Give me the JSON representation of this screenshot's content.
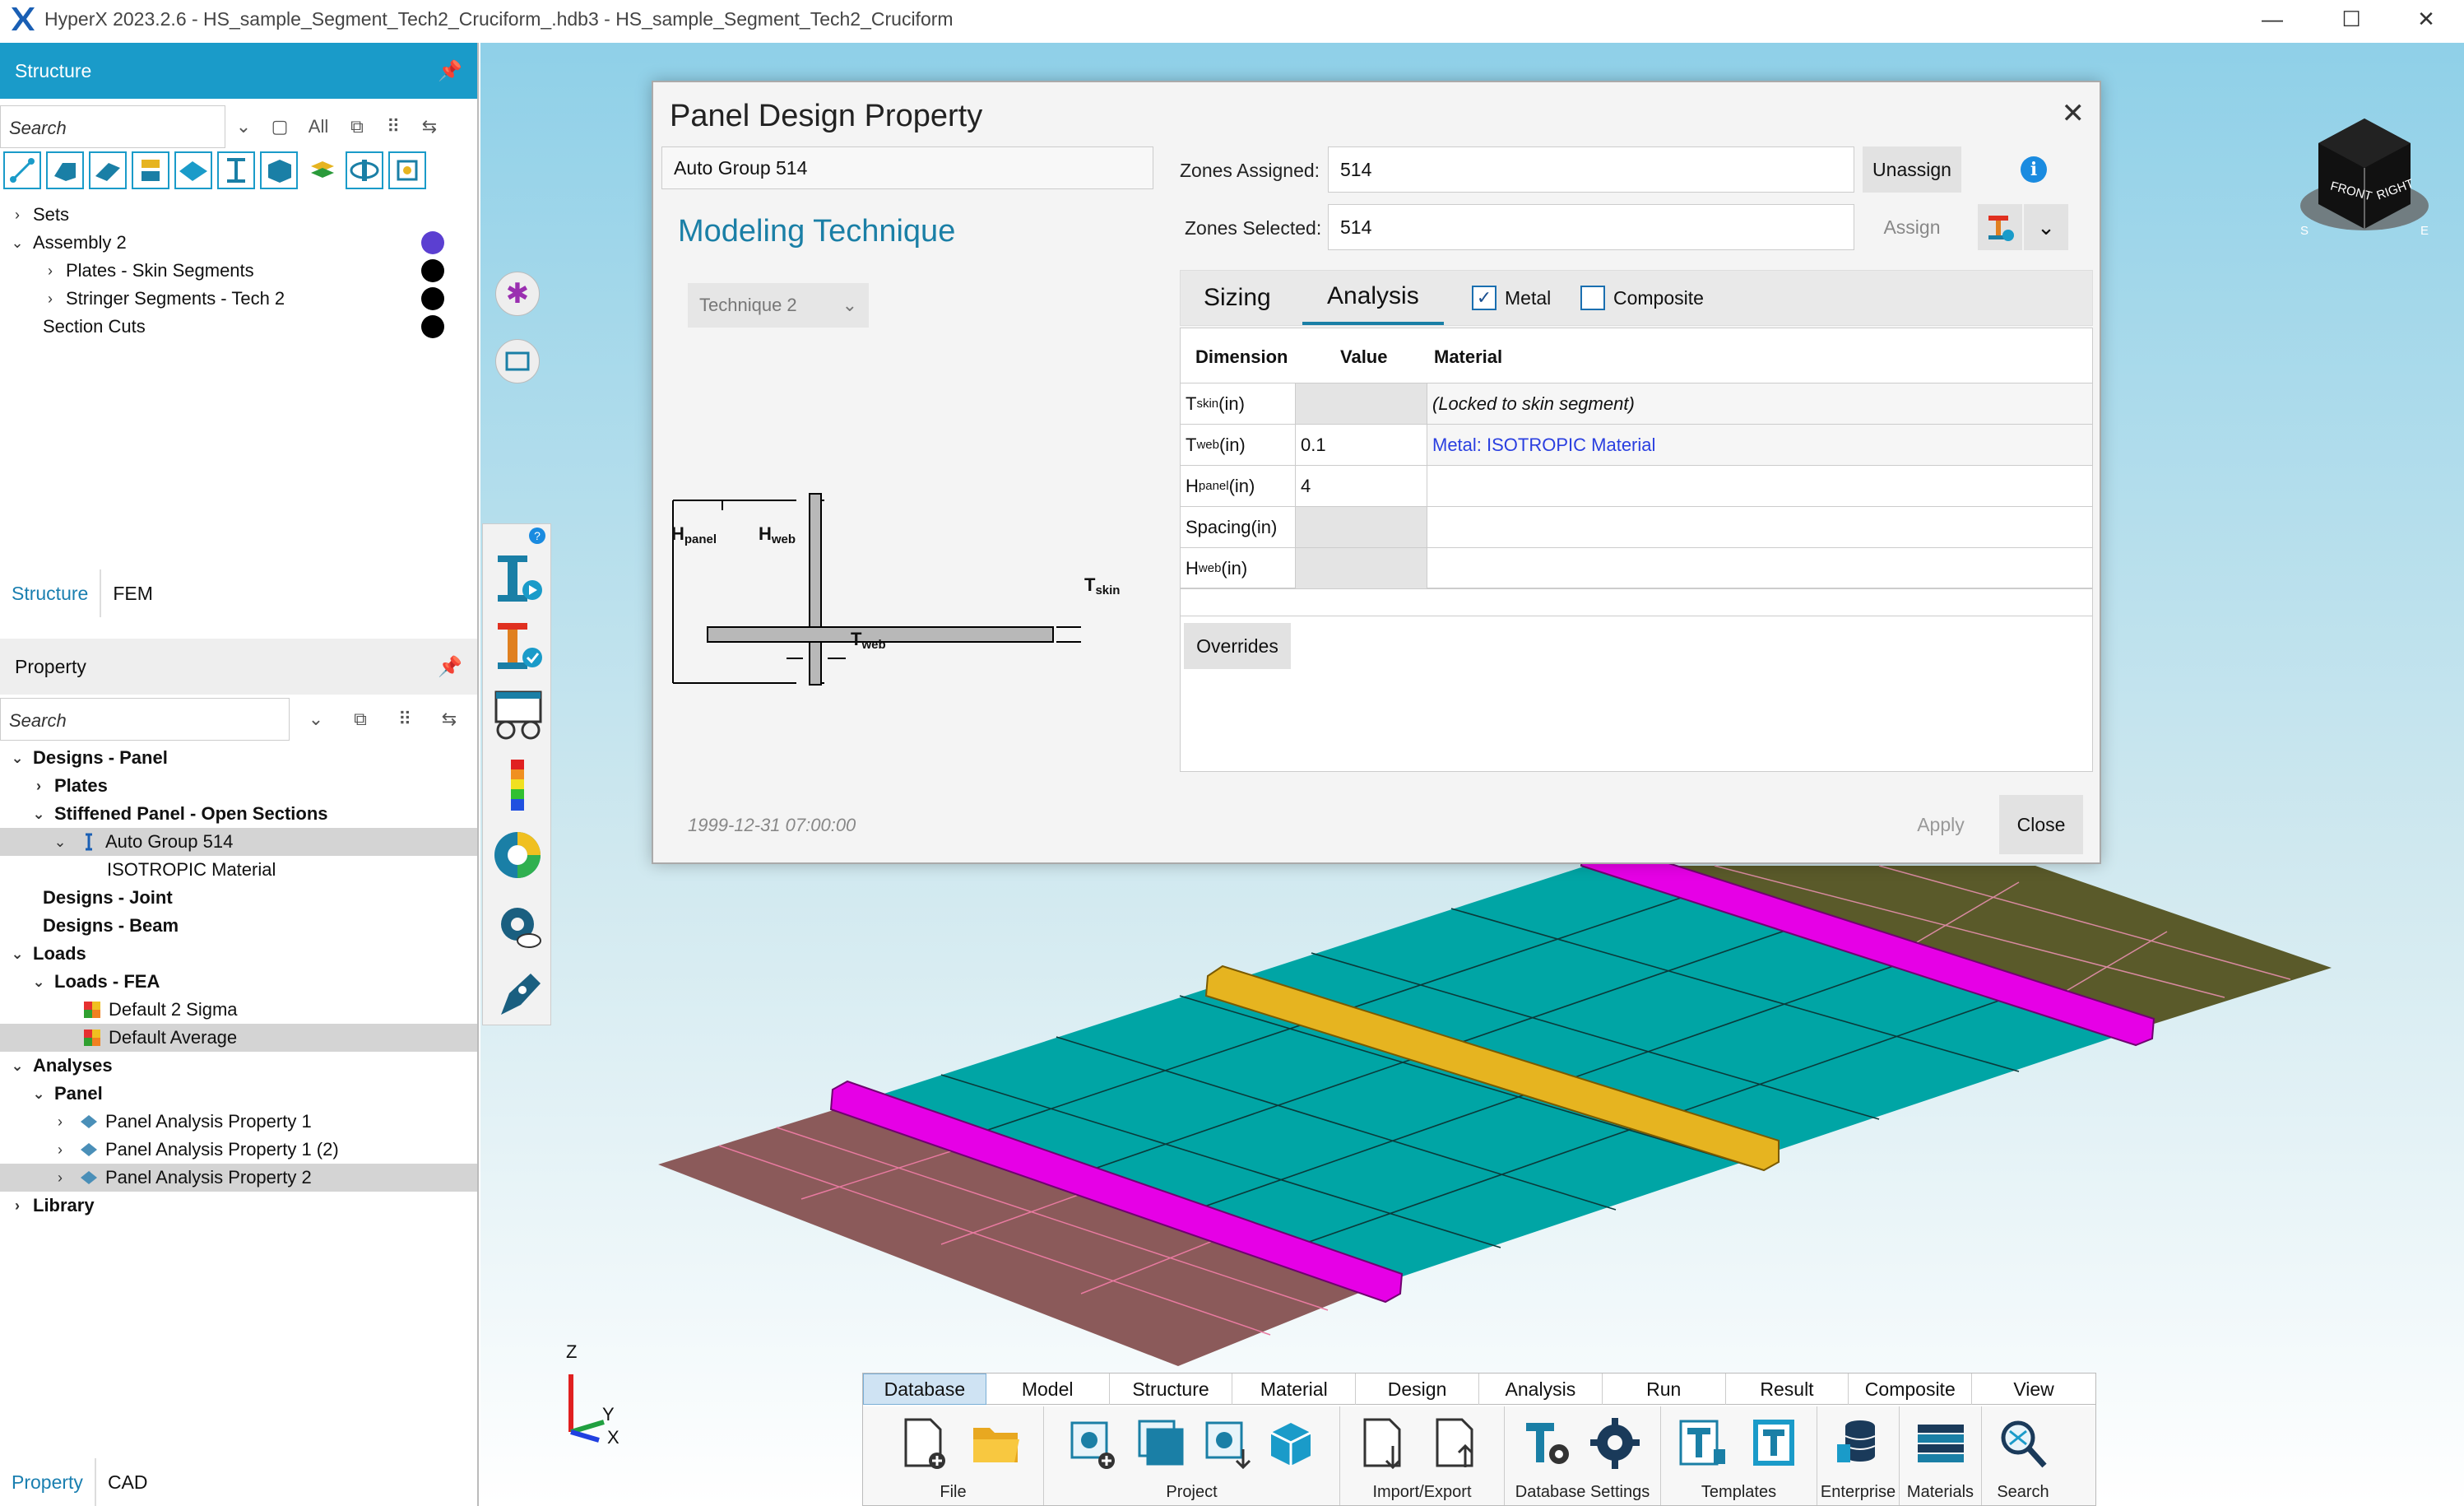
{
  "titlebar": {
    "title": "HyperX 2023.2.6 - HS_sample_Segment_Tech2_Cruciform_.hdb3 - HS_sample_Segment_Tech2_Cruciform",
    "minimize": "—",
    "maximize": "☐",
    "close": "✕"
  },
  "structure_panel": {
    "header": "Structure",
    "search_placeholder": "Search",
    "filter_all": "All",
    "tree": [
      {
        "label": "Sets",
        "level": 0,
        "expander": "›"
      },
      {
        "label": "Assembly 2",
        "level": 0,
        "expander": "⌄"
      },
      {
        "label": "Plates - Skin Segments",
        "level": 1,
        "expander": "›"
      },
      {
        "label": "Stringer Segments - Tech 2",
        "level": 1,
        "expander": "›"
      },
      {
        "label": "Section Cuts",
        "level": 0,
        "expander": ""
      }
    ],
    "tabs": [
      "Structure",
      "FEM"
    ]
  },
  "property_panel": {
    "header": "Property",
    "search_placeholder": "Search",
    "tree": [
      "Designs - Panel",
      "Plates",
      "Stiffened Panel - Open Sections",
      "Auto Group 514",
      "ISOTROPIC Material",
      "Designs - Joint",
      "Designs - Beam",
      "Loads",
      "Loads - FEA",
      "Default 2 Sigma",
      "Default Average",
      "Analyses",
      "Panel",
      "Panel Analysis Property 1",
      "Panel Analysis Property 1 (2)",
      "Panel Analysis Property 2",
      "Library"
    ],
    "tabs": [
      "Property",
      "CAD"
    ]
  },
  "dialog": {
    "title": "Panel Design Property",
    "close": "✕",
    "name_value": "Auto Group 514",
    "zones_assigned_label": "Zones Assigned:",
    "zones_assigned_value": "514",
    "zones_selected_label": "Zones Selected:",
    "zones_selected_value": "514",
    "unassign": "Unassign",
    "assign": "Assign",
    "technique_header": "Modeling Technique",
    "technique_value": "Technique 2",
    "tabs": [
      "Sizing",
      "Analysis"
    ],
    "metal_label": "Metal",
    "metal_checked": "✓",
    "composite_label": "Composite",
    "columns": [
      "Dimension",
      "Value",
      "Material"
    ],
    "rows": [
      {
        "dim": "T",
        "sub": "skin",
        "unit": " (in)",
        "value": "",
        "material": "(Locked to skin segment)"
      },
      {
        "dim": "T",
        "sub": "web",
        "unit": " (in)",
        "value": "0.1",
        "material": "Metal: ISOTROPIC Material"
      },
      {
        "dim": "H",
        "sub": "panel",
        "unit": " (in)",
        "value": "4",
        "material": ""
      },
      {
        "dim": "Spacing",
        "sub": "",
        "unit": " (in)",
        "value": "",
        "material": ""
      },
      {
        "dim": "H",
        "sub": "web",
        "unit": " (in)",
        "value": "",
        "material": ""
      }
    ],
    "overrides": "Overrides",
    "timestamp": "1999-12-31 07:00:00",
    "apply": "Apply",
    "close_button": "Close",
    "diagram_labels": {
      "h_panel": "H",
      "h_panel_sub": "panel",
      "h_web": "H",
      "h_web_sub": "web",
      "t_skin": "T",
      "t_skin_sub": "skin",
      "t_web": "T",
      "t_web_sub": "web"
    }
  },
  "viewcube": {
    "front": "FRONT",
    "right": "RIGHT",
    "s": "S",
    "e": "E"
  },
  "axes": {
    "z": "Z",
    "y": "Y",
    "x": "X"
  },
  "ribbon": {
    "tabs": [
      "Database",
      "Model",
      "Structure",
      "Material",
      "Design",
      "Analysis",
      "Run",
      "Result",
      "Composite",
      "View"
    ],
    "groups": [
      "File",
      "Project",
      "Import/Export",
      "Database Settings",
      "Templates",
      "Enterprise",
      "Materials",
      "Search"
    ]
  },
  "colors": {
    "accent": "#1a7fa6",
    "skin": "#00a5a5",
    "stringer": "#e600e6",
    "stringer_center": "#e6b420",
    "outer_skin": "#8b5a5a",
    "olive_skin": "#5a5a2a",
    "assembly_dot": "#5b3fd1"
  }
}
